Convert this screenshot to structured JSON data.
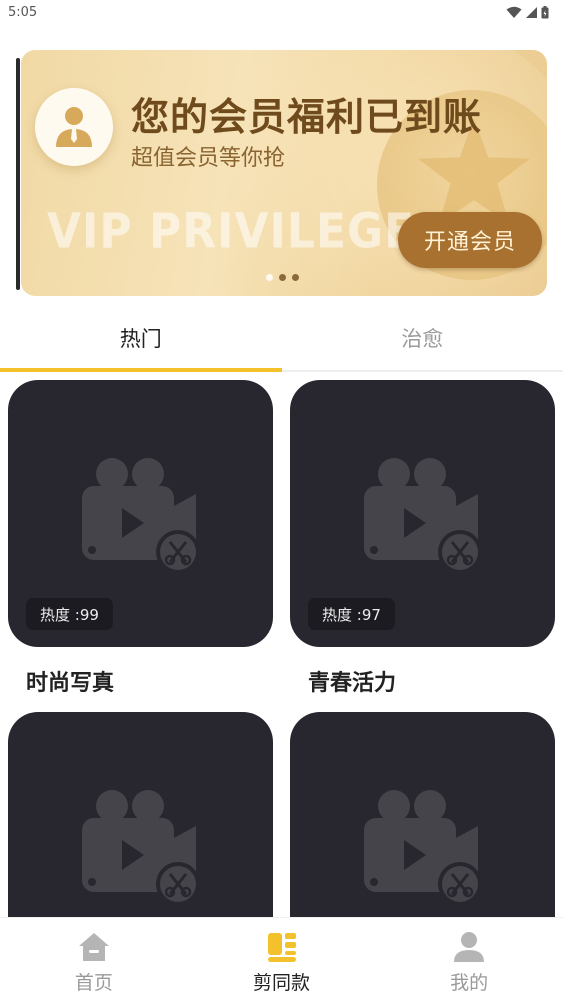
{
  "status_bar": {
    "time": "5:05"
  },
  "banner": {
    "title": "您的会员福利已到账",
    "subtitle": "超值会员等你抢",
    "watermark": "VIP PRIVILEGE",
    "button_label": "开通会员",
    "page_count": 3,
    "active_page": 1
  },
  "tabs": [
    {
      "label": "热门",
      "active": true
    },
    {
      "label": "治愈",
      "active": false
    }
  ],
  "cards": [
    {
      "title": "时尚写真",
      "hot": "热度 :99"
    },
    {
      "title": "青春活力",
      "hot": "热度 :97"
    },
    {
      "title": "",
      "hot": ""
    },
    {
      "title": "",
      "hot": ""
    }
  ],
  "bottom_nav": [
    {
      "label": "首页",
      "icon": "home-icon",
      "active": false
    },
    {
      "label": "剪同款",
      "icon": "template-icon",
      "active": true
    },
    {
      "label": "我的",
      "icon": "profile-icon",
      "active": false
    }
  ],
  "colors": {
    "accent": "#f3c12b",
    "vip_button": "#a97130",
    "card_bg": "#28272f"
  }
}
